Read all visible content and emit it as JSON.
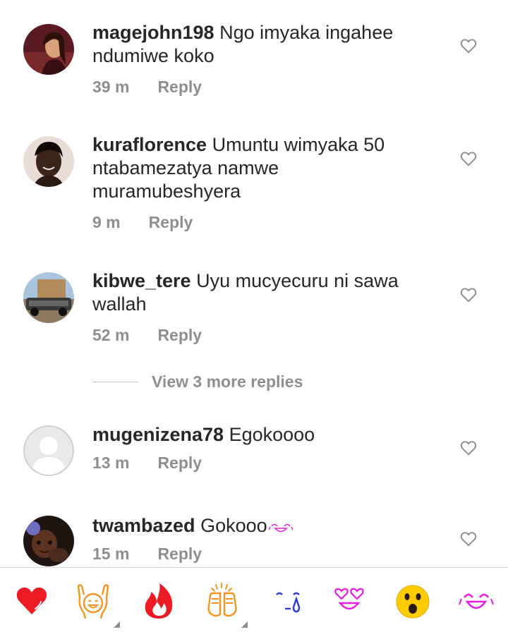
{
  "comments": [
    {
      "username": "magejohn198",
      "text": "Ngo imyaka ingahee ndumiwe koko",
      "time": "39 m",
      "reply": "Reply"
    },
    {
      "username": "kuraflorence",
      "text": "Umuntu wimyaka 50 ntabamezatya namwe muramubeshyera",
      "time": "9 m",
      "reply": "Reply"
    },
    {
      "username": "kibwe_tere",
      "text": "Uyu mucyecuru ni sawa wallah",
      "time": "52 m",
      "reply": "Reply"
    },
    {
      "username": "mugenizena78",
      "text": "Egokoooo",
      "time": "13 m",
      "reply": "Reply"
    },
    {
      "username": "twambazed",
      "text": "Gokooo",
      "time": "15 m",
      "reply": "Reply"
    }
  ],
  "view_more": "View 3 more replies",
  "emoji_bar": [
    "red-heart-icon",
    "raising-hands-icon",
    "fire-icon",
    "clapping-hands-icon",
    "crying-face-icon",
    "heart-eyes-icon",
    "astonished-face-icon",
    "laughing-face-icon"
  ],
  "colors": {
    "text": "#262626",
    "meta": "#8e8e8e",
    "divider": "#dbdbdb",
    "red": "#ed1c24",
    "orange": "#f7931e",
    "magenta": "#e81ce8"
  }
}
